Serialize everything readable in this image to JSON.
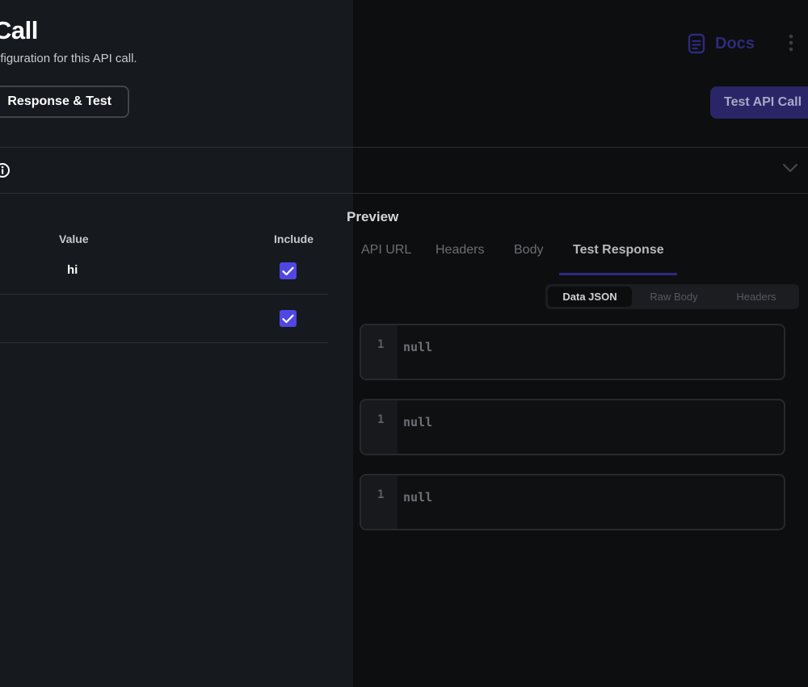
{
  "header": {
    "title": "Call",
    "subtitle": "nfiguration for this API call.",
    "active_tab": "Response & Test",
    "docs_label": "Docs",
    "test_button": "Test API Call"
  },
  "variables": {
    "columns": {
      "value": "Value",
      "include": "Include"
    },
    "rows": [
      {
        "value": "hi",
        "included": true
      },
      {
        "value": "",
        "included": true
      }
    ]
  },
  "preview": {
    "label": "Preview",
    "tabs": [
      "API URL",
      "Headers",
      "Body",
      "Test Response"
    ],
    "active_tab": "Test Response",
    "segments": [
      "Data JSON",
      "Raw Body",
      "Headers"
    ],
    "active_segment": "Data JSON",
    "code_blocks": [
      {
        "line_number": "1",
        "text": "null"
      },
      {
        "line_number": "1",
        "text": "null"
      },
      {
        "line_number": "1",
        "text": "null"
      }
    ]
  },
  "colors": {
    "accent": "#5046e4",
    "left_panel_bg": "#16191d",
    "right_bg": "#0d0e10"
  },
  "icons": {
    "docs": "document-icon",
    "more": "kebab-menu-icon",
    "info": "info-icon",
    "collapse": "chevron-down-icon",
    "check": "check-icon"
  }
}
